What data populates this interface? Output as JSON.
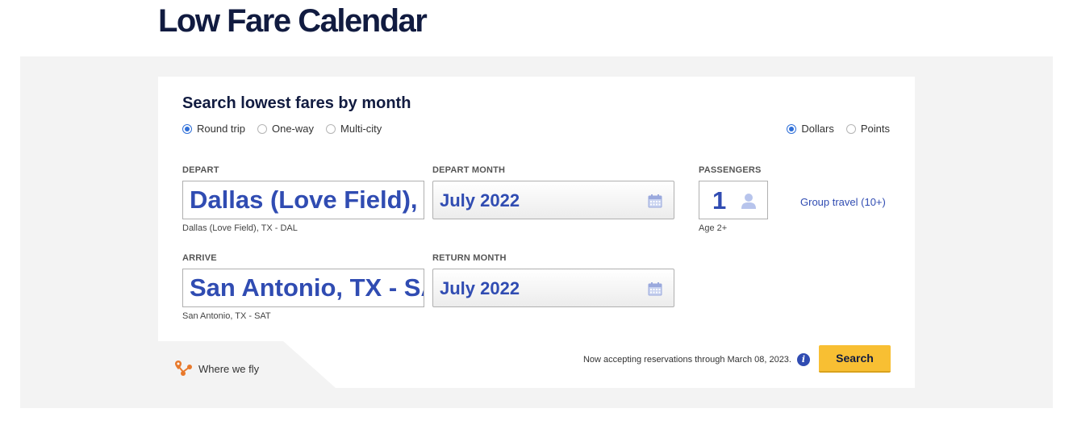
{
  "page_title": "Low Fare Calendar",
  "form": {
    "title": "Search lowest fares by month",
    "trip_types": [
      {
        "label": "Round trip",
        "checked": true
      },
      {
        "label": "One-way",
        "checked": false
      },
      {
        "label": "Multi-city",
        "checked": false
      }
    ],
    "currency": [
      {
        "label": "Dollars",
        "checked": true
      },
      {
        "label": "Points",
        "checked": false
      }
    ],
    "depart": {
      "label": "DEPART",
      "value": "Dallas (Love Field), TX - DAL",
      "helper": "Dallas (Love Field), TX - DAL"
    },
    "arrive": {
      "label": "ARRIVE",
      "value": "San Antonio, TX - SAT",
      "helper": "San Antonio, TX - SAT"
    },
    "depart_month": {
      "label": "DEPART MONTH",
      "value": "July 2022",
      "icon": "calendar-icon"
    },
    "return_month": {
      "label": "RETURN MONTH",
      "value": "July 2022",
      "icon": "calendar-icon"
    },
    "passengers": {
      "label": "PASSENGERS",
      "value": "1",
      "helper": "Age 2+",
      "icon": "person-icon"
    },
    "group_travel": "Group travel (10+)",
    "where_we_fly": "Where we fly",
    "notice": "Now accepting reservations through March 08, 2023.",
    "info_icon": "i",
    "search_label": "Search"
  },
  "colors": {
    "accent_blue": "#304cb2",
    "search_yellow": "#f8bf33",
    "title_navy": "#111b40",
    "route_orange": "#e8792b"
  }
}
